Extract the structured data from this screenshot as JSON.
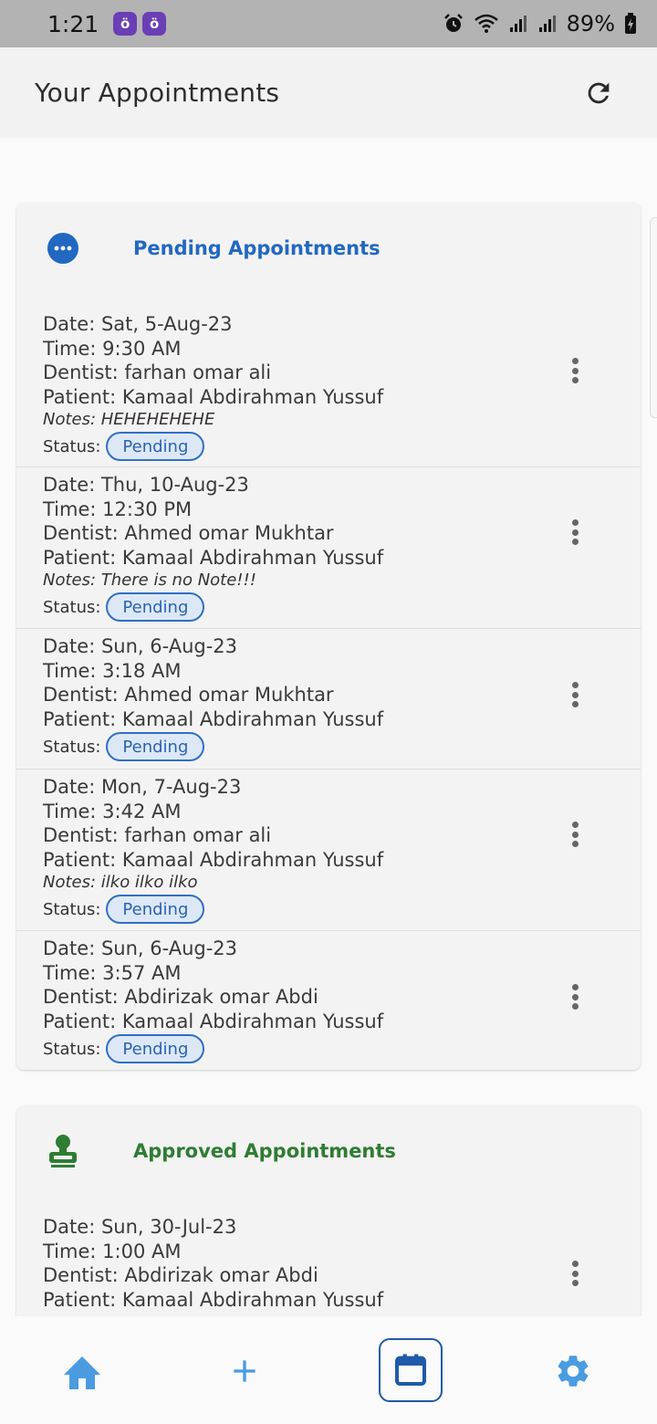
{
  "status_bar": {
    "time": "1:21",
    "notif_glyph": "ö",
    "battery": "89%",
    "icons": [
      "alarm-icon",
      "wifi-icon",
      "signal-icon",
      "signal-icon",
      "battery-icon"
    ]
  },
  "header": {
    "title": "Your Appointments",
    "refresh_icon": "refresh-icon"
  },
  "colors": {
    "primary": "#2268c1",
    "approved": "#2e7d32",
    "nav_icon": "#4a9be0"
  },
  "pending": {
    "title": "Pending Appointments",
    "icon": "more-horizontal-circle-icon",
    "items": [
      {
        "date": "Date: Sat, 5-Aug-23",
        "time": "Time: 9:30 AM",
        "dentist": "Dentist: farhan omar ali",
        "patient": "Patient: Kamaal Abdirahman Yussuf",
        "notes": "Notes: HEHEHEHEHE",
        "status_label": "Status:",
        "status": "Pending"
      },
      {
        "date": "Date: Thu, 10-Aug-23",
        "time": "Time: 12:30 PM",
        "dentist": "Dentist: Ahmed omar Mukhtar",
        "patient": "Patient: Kamaal Abdirahman Yussuf",
        "notes": "Notes: There is no Note!!!",
        "status_label": "Status:",
        "status": "Pending"
      },
      {
        "date": "Date: Sun, 6-Aug-23",
        "time": "Time: 3:18 AM",
        "dentist": "Dentist: Ahmed omar Mukhtar",
        "patient": "Patient: Kamaal Abdirahman Yussuf",
        "status_label": "Status:",
        "status": "Pending"
      },
      {
        "date": "Date: Mon, 7-Aug-23",
        "time": "Time: 3:42 AM",
        "dentist": "Dentist: farhan omar ali",
        "patient": "Patient: Kamaal Abdirahman Yussuf",
        "notes": "Notes: ilko ilko ilko",
        "status_label": "Status:",
        "status": "Pending"
      },
      {
        "date": "Date: Sun, 6-Aug-23",
        "time": "Time: 3:57 AM",
        "dentist": "Dentist: Abdirizak omar Abdi",
        "patient": "Patient: Kamaal Abdirahman Yussuf",
        "status_label": "Status:",
        "status": "Pending"
      }
    ]
  },
  "approved": {
    "title": "Approved Appointments",
    "icon": "stamp-icon",
    "items": [
      {
        "date": "Date: Sun, 30-Jul-23",
        "time": "Time: 1:00 AM",
        "dentist": "Dentist: Abdirizak omar Abdi",
        "patient": "Patient: Kamaal Abdirahman Yussuf"
      }
    ]
  },
  "bottom_nav": {
    "items": [
      "home-icon",
      "add-icon",
      "calendar-icon",
      "settings-icon"
    ],
    "active": "calendar-icon"
  }
}
